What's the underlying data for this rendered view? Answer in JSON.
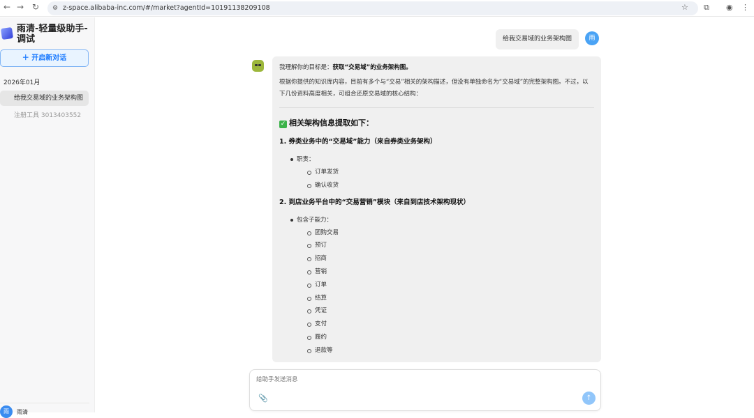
{
  "browser": {
    "url": "z-space.alibaba-inc.com/#/market?agentId=10191138209108"
  },
  "sidebar": {
    "title": "雨清-轻量级助手-调试",
    "new_chat": "＋ 开启新对话",
    "month": "2026年01月",
    "history": [
      {
        "label": "给我交易域的业务架构图"
      },
      {
        "label": "注册工具 3013403552"
      }
    ],
    "user_avatar": "雨",
    "user_name": "雨清"
  },
  "chat": {
    "user_message": "给我交易域的业务架构图",
    "user_avatar": "雨",
    "reply": {
      "intro_prefix": "我理解你的目标是：",
      "intro_bold": "获取“交易域”的业务架构图。",
      "para": "根据你提供的知识库内容，目前有多个与“交易”相关的架构描述，但没有单独命名为“交易域”的完整架构图。不过，以下几份资料高度相关，可组合还原交易域的核心结构：",
      "heading": "相关架构信息提取如下：",
      "sec1": {
        "title": "1. 券类业务中的“交易域”能力（来自券类业务架构）",
        "bullet": "职责：",
        "items": [
          "订单发货",
          "确认收货"
        ]
      },
      "sec2": {
        "title": "2. 到店业务平台中的“交易营销”模块（来自到店技术架构现状）",
        "bullet": "包含子能力：",
        "items": [
          "团购交易",
          "预订",
          "招商",
          "营销",
          "订单",
          "结算",
          "凭证",
          "支付",
          "履约",
          "退款等"
        ]
      }
    }
  },
  "input": {
    "placeholder": "给助手发送消息"
  }
}
